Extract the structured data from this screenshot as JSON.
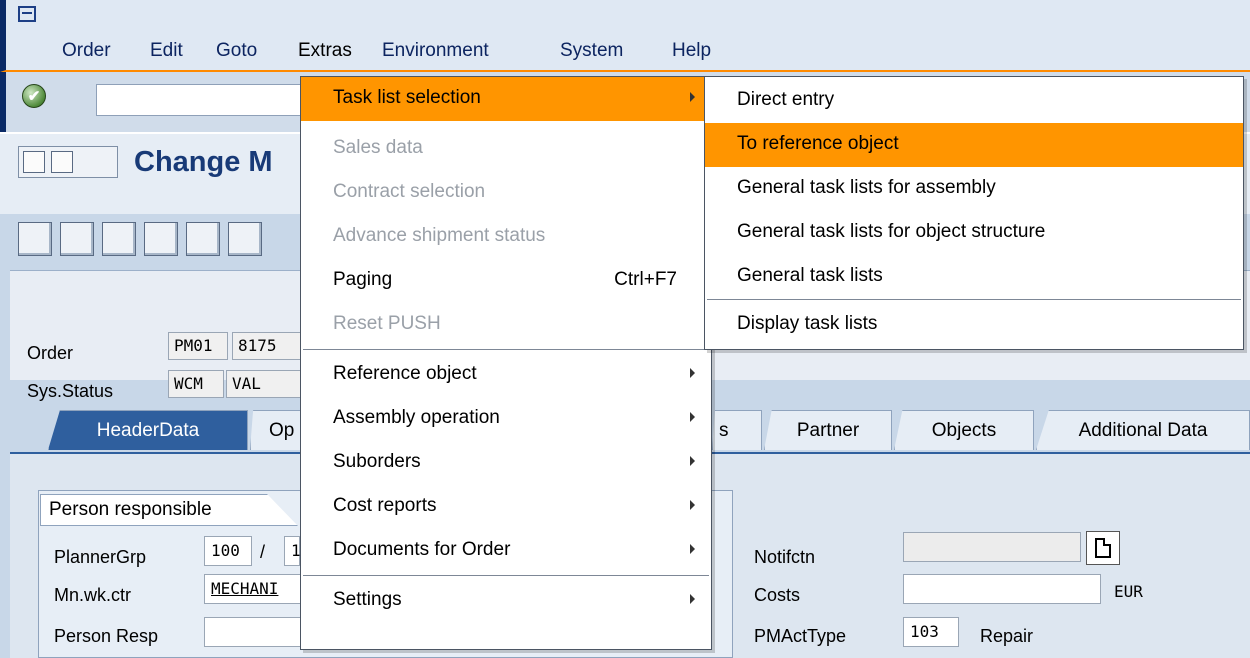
{
  "menubar": {
    "items": [
      "Order",
      "Edit",
      "Goto",
      "Extras",
      "Environment",
      "System",
      "Help"
    ]
  },
  "title": {
    "text": "Change M"
  },
  "header": {
    "order_label": "Order",
    "order_type": "PM01",
    "order_number": "8175",
    "sys_status_label": "Sys.Status",
    "sys_status_1": "WCM",
    "sys_status_2": "VAL"
  },
  "tabs": [
    "HeaderData",
    "Op",
    "s",
    "Partner",
    "Objects",
    "Additional Data"
  ],
  "tab_content": {
    "group_title": "Person responsible",
    "planner_grp_label": "PlannerGrp",
    "planner_grp_value": "100",
    "planner_grp_sep": "/",
    "planner_grp_value2": "1",
    "mn_wk_ctr_label": "Mn.wk.ctr",
    "mn_wk_ctr_value": "MECHANI",
    "person_resp_label": "Person Resp",
    "notifctn_label": "Notifctn",
    "costs_label": "Costs",
    "costs_currency": "EUR",
    "pmact_type_label": "PMActType",
    "pmact_type_value": "103",
    "pmact_type_text": "Repair"
  },
  "extras_menu": {
    "items": [
      {
        "label": "Task list selection",
        "state": "highlight",
        "submenu": true
      },
      {
        "label": "Sales data",
        "state": "disabled"
      },
      {
        "label": "Contract selection",
        "state": "disabled"
      },
      {
        "label": "Advance shipment status",
        "state": "disabled"
      },
      {
        "label": "Paging",
        "shortcut": "Ctrl+F7"
      },
      {
        "label": "Reset PUSH",
        "state": "disabled"
      },
      {
        "label": "Reference object",
        "submenu": true
      },
      {
        "label": "Assembly operation",
        "submenu": true
      },
      {
        "label": "Suborders",
        "submenu": true
      },
      {
        "label": "Cost reports",
        "submenu": true
      },
      {
        "label": "Documents for Order",
        "submenu": true
      },
      {
        "label": "Settings",
        "submenu": true
      }
    ]
  },
  "task_list_submenu": {
    "items": [
      {
        "label": "Direct entry"
      },
      {
        "label": "To reference object",
        "state": "highlight"
      },
      {
        "label": "General task lists for assembly"
      },
      {
        "label": "General task lists for object structure"
      },
      {
        "label": "General task lists"
      },
      {
        "label": "Display task lists"
      }
    ]
  },
  "colors": {
    "highlight": "#ff9500",
    "title": "#183a77",
    "active_tab": "#2f5f9e"
  }
}
